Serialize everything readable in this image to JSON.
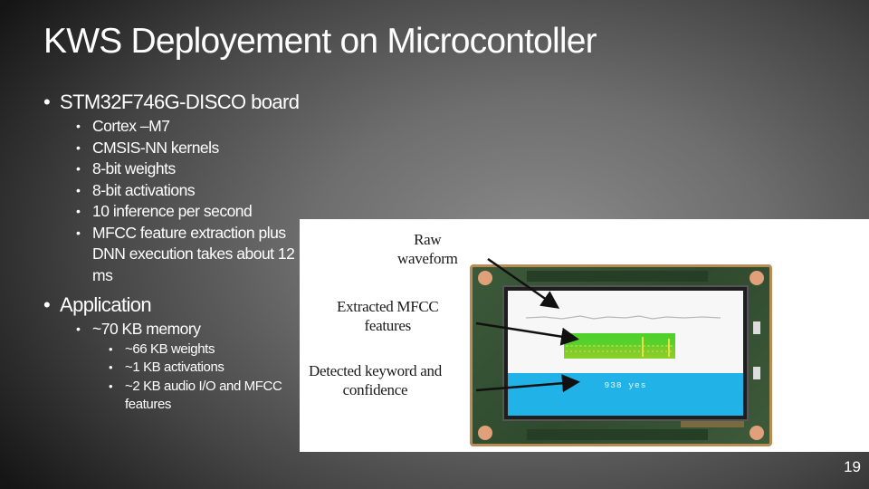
{
  "slide": {
    "title": "KWS Deployement on Microcontoller",
    "page_number": "19",
    "bullets": [
      {
        "text": "STM32F746G-DISCO board",
        "children": [
          {
            "text": "Cortex –M7"
          },
          {
            "text": "CMSIS-NN kernels"
          },
          {
            "text": "8-bit weights"
          },
          {
            "text": "8-bit activations"
          },
          {
            "text": "10 inference per second"
          },
          {
            "text": "MFCC feature extraction plus DNN execution takes about 12 ms"
          }
        ]
      },
      {
        "text": "Application",
        "children": [
          {
            "text": "~70 KB memory",
            "children": [
              {
                "text": "~66 KB weights"
              },
              {
                "text": "~1 KB activations"
              },
              {
                "text": "~2 KB audio I/O and MFCC features"
              }
            ]
          }
        ]
      }
    ]
  },
  "figure": {
    "labels": {
      "raw_waveform_line1": "Raw",
      "raw_waveform_line2": "waveform",
      "mfcc_line1": "Extracted MFCC",
      "mfcc_line2": "features",
      "keyword_line1": "Detected keyword and",
      "keyword_line2": "confidence"
    },
    "screen": {
      "detected_text": "938 yes"
    },
    "colors": {
      "screen_blue": "#21b3e8",
      "mfcc_green": "#4cd12a",
      "board_green": "#2f4a2e"
    }
  }
}
